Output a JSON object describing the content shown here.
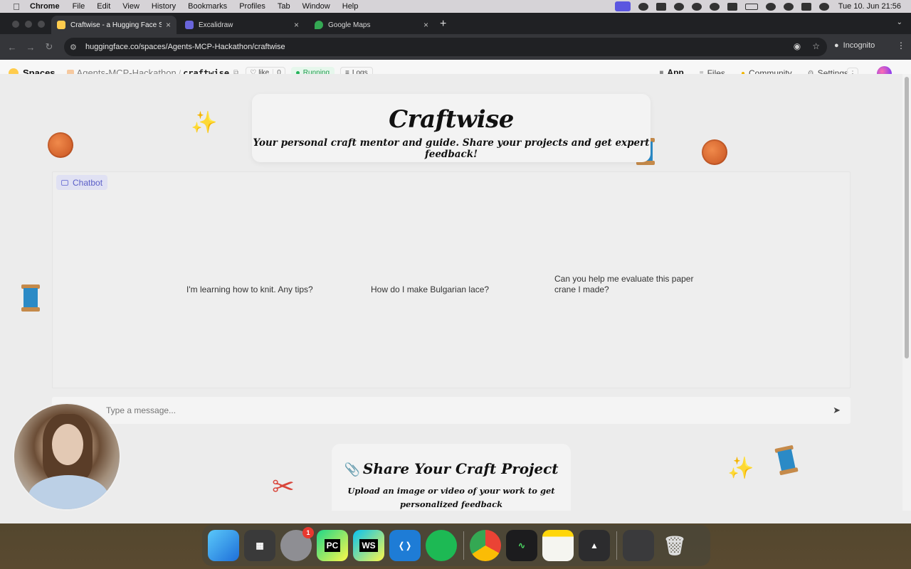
{
  "menubar": {
    "app_name": "Chrome",
    "items": [
      "File",
      "Edit",
      "View",
      "History",
      "Bookmarks",
      "Profiles",
      "Tab",
      "Window",
      "Help"
    ],
    "clock": "Tue 10. Jun  21:56"
  },
  "browser": {
    "tabs": [
      {
        "label": "Craftwise - a Hugging Face S",
        "favicon_color": "#ffcc4d"
      },
      {
        "label": "Excalidraw",
        "favicon_color": "#6965db"
      },
      {
        "label": "Google Maps",
        "favicon_color": "#34a853"
      }
    ],
    "url": "huggingface.co/spaces/Agents-MCP-Hackathon/craftwise",
    "incognito_label": "Incognito"
  },
  "hf": {
    "spaces_label": "Spaces",
    "org": "Agents-MCP-Hackathon",
    "repo": "craftwise",
    "like_label": "like",
    "like_count": "0",
    "status": "Running",
    "logs_label": "Logs",
    "nav": [
      "App",
      "Files",
      "Community",
      "Settings"
    ]
  },
  "app": {
    "title": "Craftwise",
    "subtitle": "Your personal craft mentor and guide. Share your projects and get expert feedback!",
    "chatbot_label": "Chatbot",
    "examples": [
      "I'm learning how to knit. Any tips?",
      "How do I make Bulgarian lace?",
      "Can you help me evaluate this paper crane I made?"
    ],
    "message_placeholder": "Type a message...",
    "share_title": "Share Your Craft Project",
    "share_subtitle": "Upload an image or video of your work to get personalized feedback"
  },
  "dock": {
    "settings_badge": "1",
    "pycharm_label": "PC",
    "webstorm_label": "WS"
  }
}
